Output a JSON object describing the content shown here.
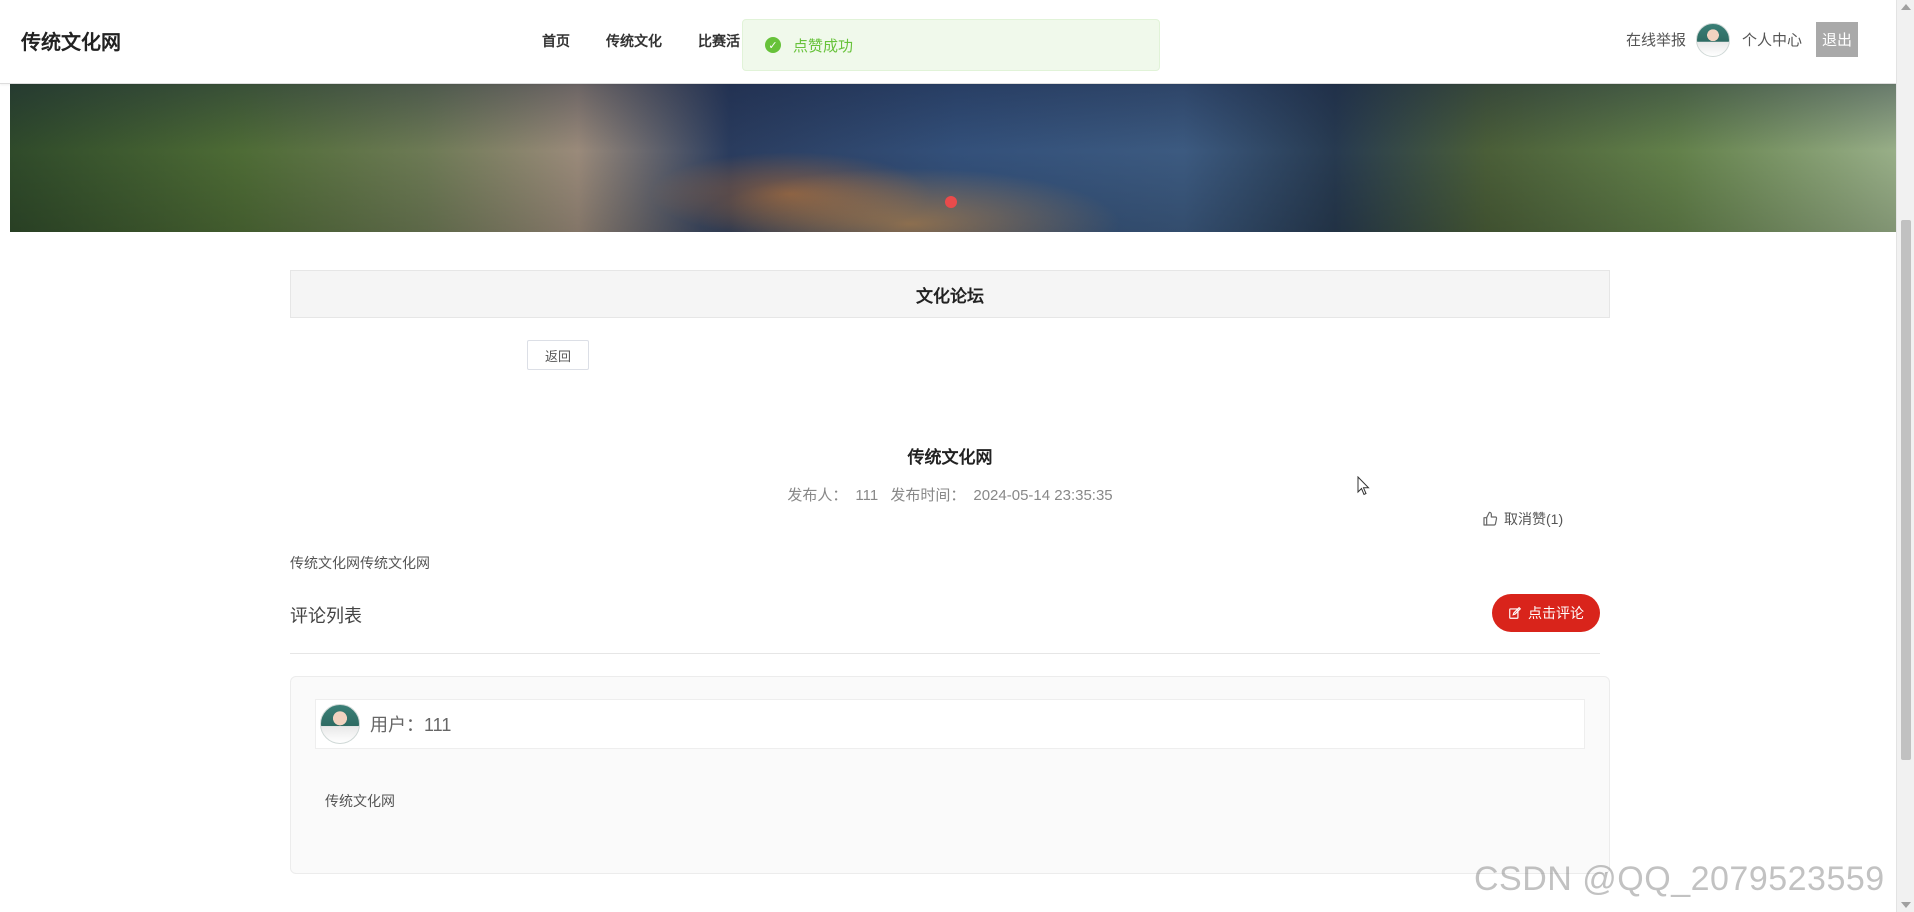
{
  "header": {
    "logo": "传统文化网",
    "nav": [
      {
        "label": "首页"
      },
      {
        "label": "传统文化"
      },
      {
        "label": "比赛活"
      }
    ],
    "report_label": "在线举报",
    "personal_label": "个人中心",
    "logout_label": "退出"
  },
  "toast": {
    "message": "点赞成功",
    "color": "#67c23a"
  },
  "section": {
    "title": "文化论坛",
    "back_label": "返回"
  },
  "post": {
    "title": "传统文化网",
    "author_label": "发布人：",
    "author": "111",
    "time_label": "发布时间：",
    "time": "2024-05-14 23:35:35",
    "like_label": "取消赞(1)",
    "content": "传统文化网传统文化网"
  },
  "comments": {
    "list_label": "评论列表",
    "button_label": "点击评论",
    "button_color": "#d9241b",
    "items": [
      {
        "user": "用户：111",
        "text": "传统文化网"
      }
    ]
  },
  "watermark": "CSDN @QQ_2079523559"
}
